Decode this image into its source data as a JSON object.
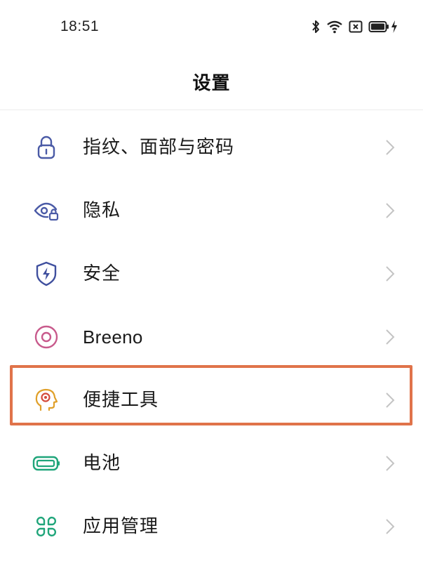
{
  "status_bar": {
    "time": "18:51",
    "icons": [
      "bluetooth-icon",
      "wifi-icon",
      "no-sim-icon",
      "battery-icon",
      "charging-icon"
    ]
  },
  "header": {
    "title": "设置"
  },
  "settings": {
    "items": [
      {
        "label": "指纹、面部与密码",
        "icon": "lock-icon",
        "color": "#4a5aa6"
      },
      {
        "label": "隐私",
        "icon": "privacy-eye-icon",
        "color": "#4a5aa6"
      },
      {
        "label": "安全",
        "icon": "shield-icon",
        "color": "#3f4f9e"
      },
      {
        "label": "Breeno",
        "icon": "breeno-icon",
        "color": "#c85a8c"
      },
      {
        "label": "便捷工具",
        "icon": "tools-head-icon",
        "color": "#e0a02a"
      },
      {
        "label": "电池",
        "icon": "battery-setting-icon",
        "color": "#1fa57a"
      },
      {
        "label": "应用管理",
        "icon": "apps-grid-icon",
        "color": "#1fa57a"
      }
    ]
  },
  "highlight": {
    "target": "便捷工具",
    "color": "#e0734a"
  }
}
